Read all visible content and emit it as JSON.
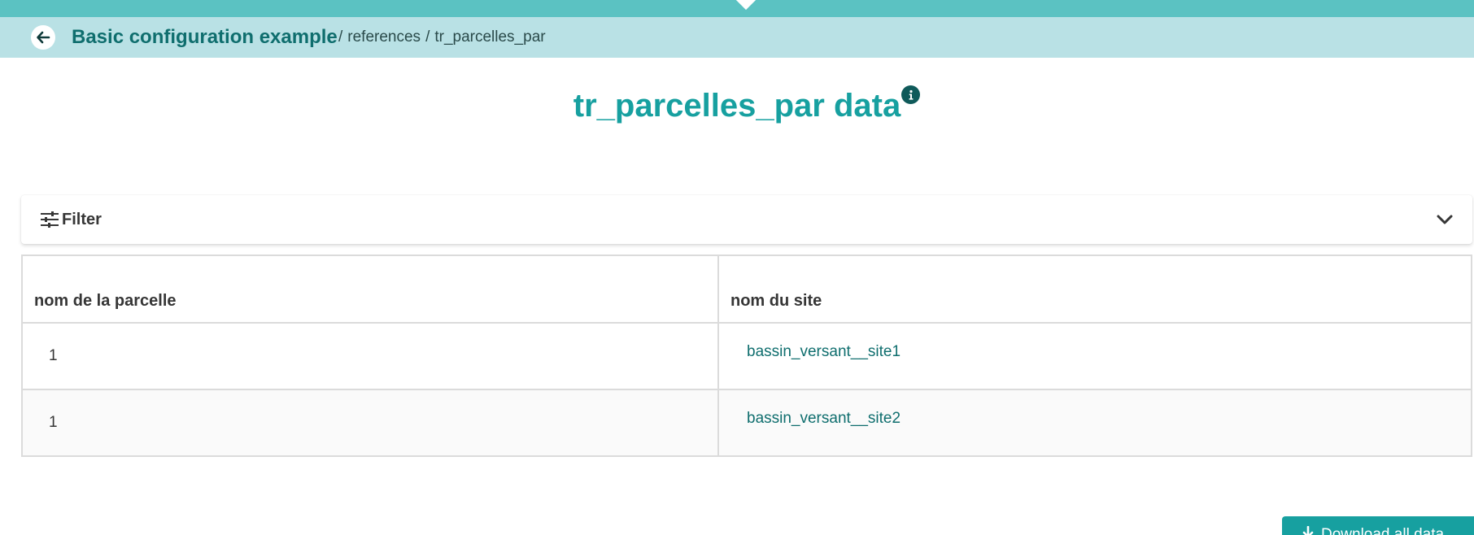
{
  "breadcrumb": {
    "home": "Basic configuration example",
    "separator": "/",
    "items": [
      "references",
      "tr_parcelles_par"
    ]
  },
  "page": {
    "title": "tr_parcelles_par data"
  },
  "filter": {
    "label": "Filter"
  },
  "table": {
    "columns": [
      "nom de la parcelle",
      "nom du site"
    ],
    "rows": [
      {
        "parcelle": "1",
        "site": "bassin_versant__site1"
      },
      {
        "parcelle": "1",
        "site": "bassin_versant__site2"
      }
    ]
  },
  "download": {
    "label": "Download all data"
  },
  "colors": {
    "topbar": "#5bc2c2",
    "breadcrumb_bg": "#b9e1e5",
    "primary": "#17a0a0",
    "link": "#0f6e6e"
  },
  "icons": {
    "back": "arrow-left-icon",
    "info": "info-icon",
    "filter": "sliders-icon",
    "expand": "chevron-down-icon",
    "download": "download-icon"
  }
}
